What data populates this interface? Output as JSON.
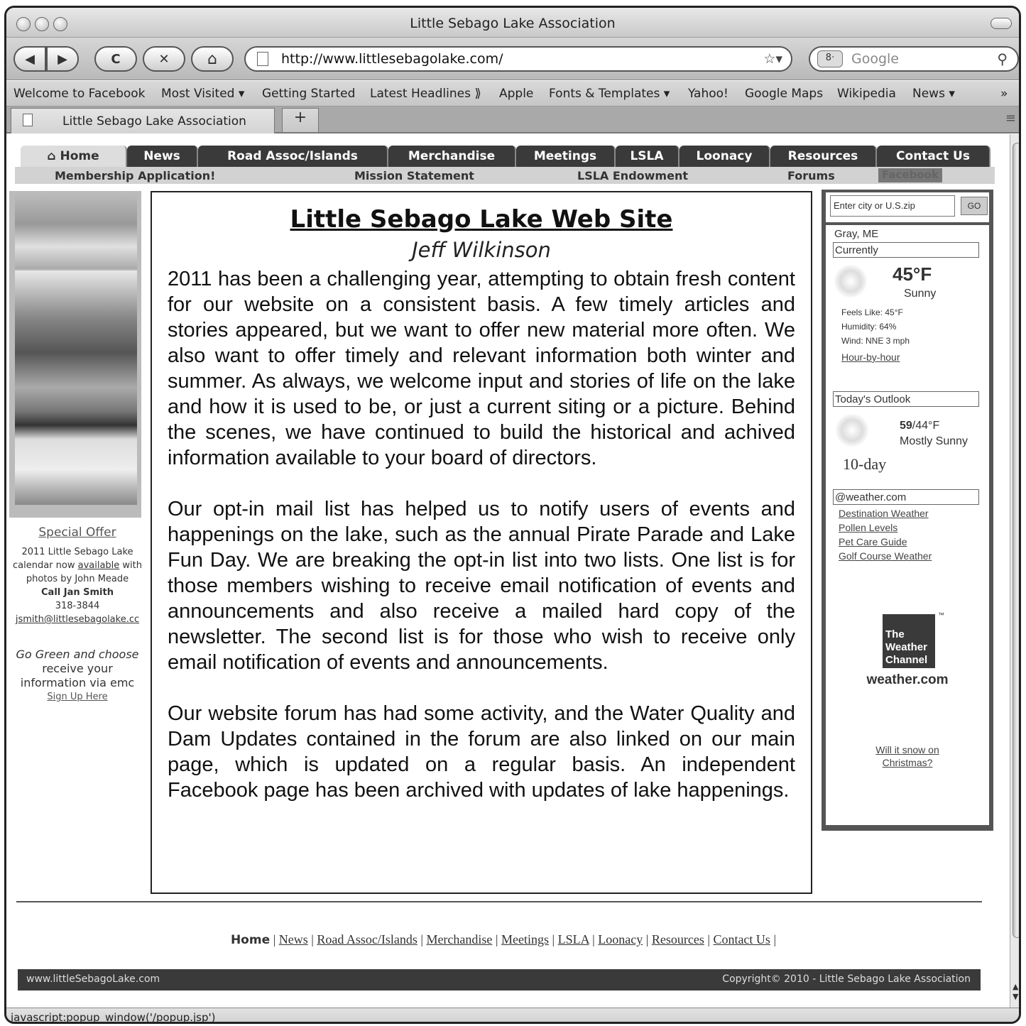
{
  "window": {
    "title": "Little Sebago Lake Association"
  },
  "toolbar": {
    "back": "◀",
    "forward": "▶",
    "reload": "C",
    "stop": "✕",
    "home": "⌂",
    "url": "http://www.littlesebagolake.com/",
    "star": "☆▾",
    "search_placeholder": "Google",
    "search_engine": "8·"
  },
  "bookmarks": [
    "Welcome to Facebook",
    "Most Visited ▾",
    "Getting Started",
    "Latest Headlines ⟫",
    "Apple",
    "Fonts & Templates ▾",
    "Yahoo!",
    "Google Maps",
    "Wikipedia",
    "News ▾",
    "»"
  ],
  "tabs": {
    "active": "Little Sebago Lake Association",
    "new": "+"
  },
  "nav": {
    "items": [
      "⌂ Home",
      "News",
      "Road Assoc/Islands",
      "Merchandise",
      "Meetings",
      "LSLA",
      "Loonacy",
      "Resources",
      "Contact Us"
    ],
    "sub": [
      "Membership Application!",
      "Mission Statement",
      "LSLA Endowment",
      "Forums",
      "Facebook"
    ]
  },
  "left": {
    "offer": "Special Offer",
    "cal1": "2011 Little Sebago Lake",
    "cal2a": "calendar now ",
    "cal2b": "available",
    "cal2c": " with",
    "cal3": "photos by John Meade",
    "cal4": "Call Jan Smith",
    "cal5": "318-3844",
    "email": "jsmith@littlesebagolake.cc",
    "green1": "Go Green and choose",
    "green2": "receive your",
    "green3": "information via emc",
    "signup": "Sign Up Here"
  },
  "article": {
    "title": "Little Sebago Lake Web Site",
    "author": "Jeff Wilkinson",
    "p1": "2011 has been a challenging year, attempting to obtain fresh content for our website on a consistent basis. A few timely articles and stories appeared, but we want to offer new material more often. We also want to offer timely and relevant information both winter and summer.  As always, we welcome input and stories of life on the lake and how it is used to be, or just a current siting or a picture.  Behind the scenes, we have continued to build the historical and achived information available to your board of directors.",
    "p2": "Our opt-in mail list has helped us to notify users of events and happenings on the lake, such as the annual Pirate Parade and Lake Fun Day. We are breaking the opt-in list into two lists. One list is for those members wishing to receive email notification of events and announcements and also receive a mailed hard copy of the newsletter.  The second list is for those who wish to receive only email notification of events and announcements.",
    "p3": "Our website forum has had some activity, and the Water Quality and Dam Updates contained in the forum are also linked on our main page, which is updated on a regular basis.  An independent Facebook page has been archived with updates of lake happenings."
  },
  "weather": {
    "search_placeholder": "Enter city or U.S.zip",
    "go": "GO",
    "location": "Gray, ME",
    "currently": "Currently",
    "temp": "45°F",
    "cond": "Sunny",
    "feels": "Feels Like: 45°F",
    "humidity": "Humidity: 64%",
    "wind": "Wind: NNE 3 mph",
    "hourly": "Hour-by-hour",
    "outlook": "Today's Outlook",
    "hi": "59",
    "lo": "/44°F",
    "out_cond": "Mostly Sunny",
    "tenday": "10-day",
    "brand_box": "@weather.com",
    "links": [
      "Destination Weather",
      "Pollen Levels",
      "Pet Care Guide",
      "Golf Course Weather"
    ],
    "twc1": "The",
    "twc2": "Weather",
    "twc3": "Channel",
    "twc_tm": "™",
    "wcom": "weather.com",
    "snow1": "Will it snow on",
    "snow2": "Christmas?"
  },
  "footer": {
    "home": "Home",
    "links": [
      "News",
      "Road Assoc/Islands",
      "Merchandise",
      "Meetings",
      "LSLA",
      "Loonacy",
      "Resources",
      "Contact Us"
    ],
    "site": "www.littleSebagoLake.com",
    "copyright": "Copyright© 2010 - Little Sebago Lake Association"
  },
  "status": "javascript:popup_window('/popup.jsp')"
}
